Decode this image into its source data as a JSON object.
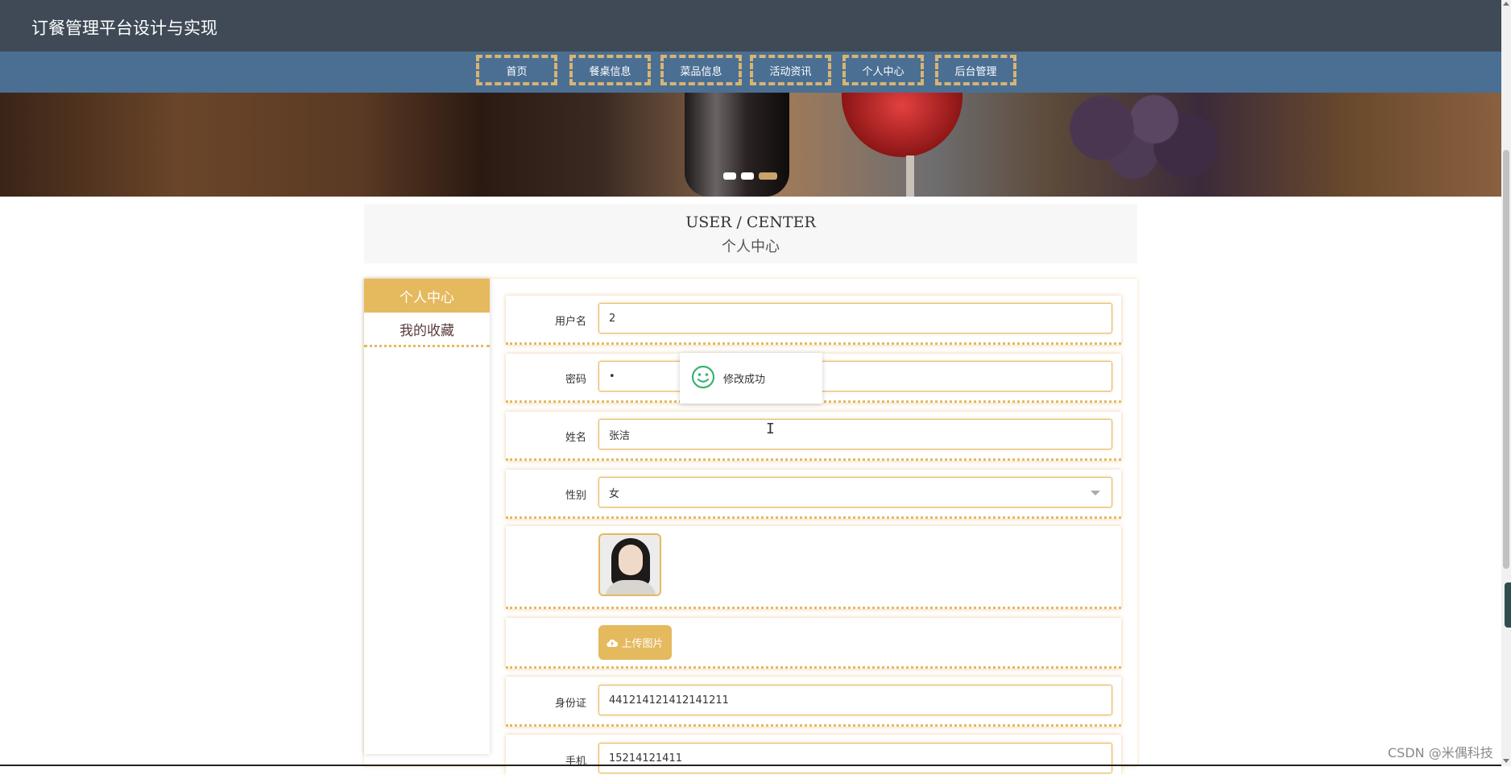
{
  "header": {
    "site_title": "订餐管理平台设计与实现"
  },
  "nav": {
    "items": [
      {
        "label": "首页"
      },
      {
        "label": "餐桌信息"
      },
      {
        "label": "菜品信息"
      },
      {
        "label": "活动资讯"
      },
      {
        "label": "个人中心"
      },
      {
        "label": "后台管理"
      }
    ]
  },
  "banner": {
    "slide_count": 3,
    "active_slide": 3,
    "dot_color": "#ffffff",
    "active_dot_color": "#c9a36a"
  },
  "section": {
    "title_en": "USER / CENTER",
    "title_cn": "个人中心"
  },
  "sidebar": {
    "items": [
      {
        "label": "个人中心"
      },
      {
        "label": "我的收藏"
      }
    ]
  },
  "form": {
    "username": {
      "label": "用户名",
      "value": "2"
    },
    "password": {
      "label": "密码",
      "value": "•"
    },
    "name": {
      "label": "姓名",
      "value": "张洁"
    },
    "gender": {
      "label": "性别",
      "value": "女"
    },
    "upload_button": {
      "label": "上传图片"
    },
    "id_card": {
      "label": "身份证",
      "value": "441214121412141211"
    },
    "phone": {
      "label": "手机",
      "value": "15214121411"
    }
  },
  "toast": {
    "message": "修改成功",
    "icon": "smiley-icon"
  },
  "watermark": "CSDN @米偶科技",
  "colors": {
    "accent": "#e5b95e",
    "topbar": "#3f4a56",
    "navbar": "#4a6f93",
    "toast_icon": "#3cb371"
  }
}
